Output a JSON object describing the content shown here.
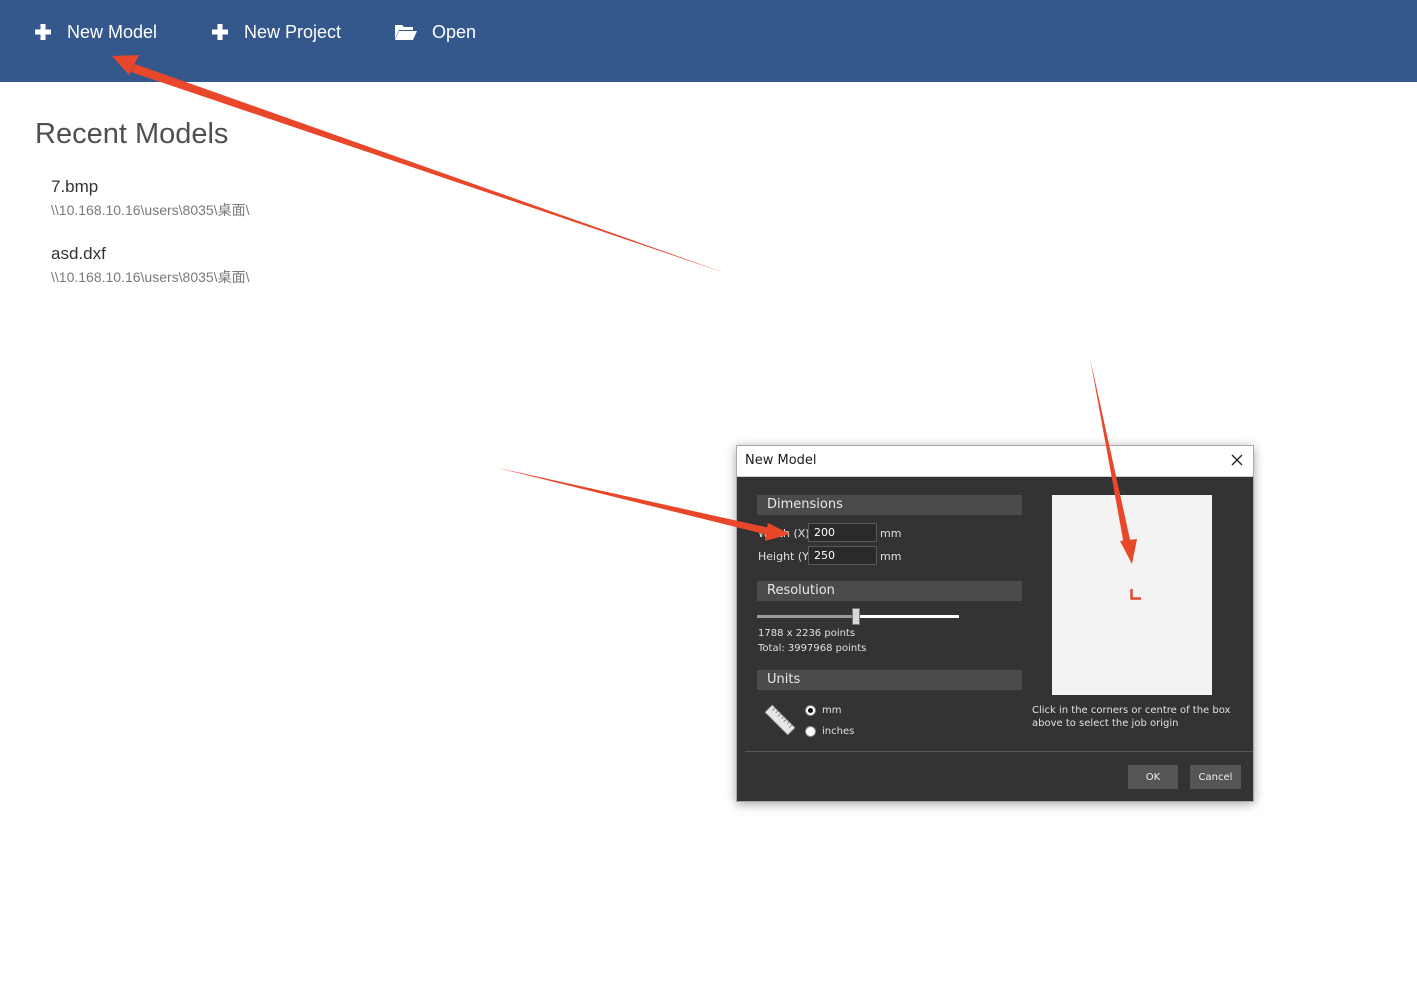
{
  "toolbar": {
    "new_model_label": "New Model",
    "new_project_label": "New Project",
    "open_label": "Open",
    "background_color": "#35588c"
  },
  "recent": {
    "title": "Recent Models",
    "items": [
      {
        "name": "7.bmp",
        "path": "\\\\10.168.10.16\\users\\8035\\桌面\\"
      },
      {
        "name": "asd.dxf",
        "path": "\\\\10.168.10.16\\users\\8035\\桌面\\"
      }
    ]
  },
  "dialog": {
    "title": "New Model",
    "dimensions": {
      "header": "Dimensions",
      "width_label": "Width (X)",
      "height_label": "Height (Y)",
      "width_value": "200",
      "height_value": "250",
      "width_unit": "mm",
      "height_unit": "mm"
    },
    "resolution": {
      "header": "Resolution",
      "slider_level": 0.5,
      "points_text": "1788 x 2236 points",
      "total_text": "Total: 3997968 points"
    },
    "units": {
      "header": "Units",
      "options": [
        "mm",
        "inches"
      ],
      "selected": "mm"
    },
    "preview_hint": "Click in the corners or centre of the box above to select the job origin",
    "ok_label": "OK",
    "cancel_label": "Cancel"
  },
  "annotation_color": "#e8472a"
}
